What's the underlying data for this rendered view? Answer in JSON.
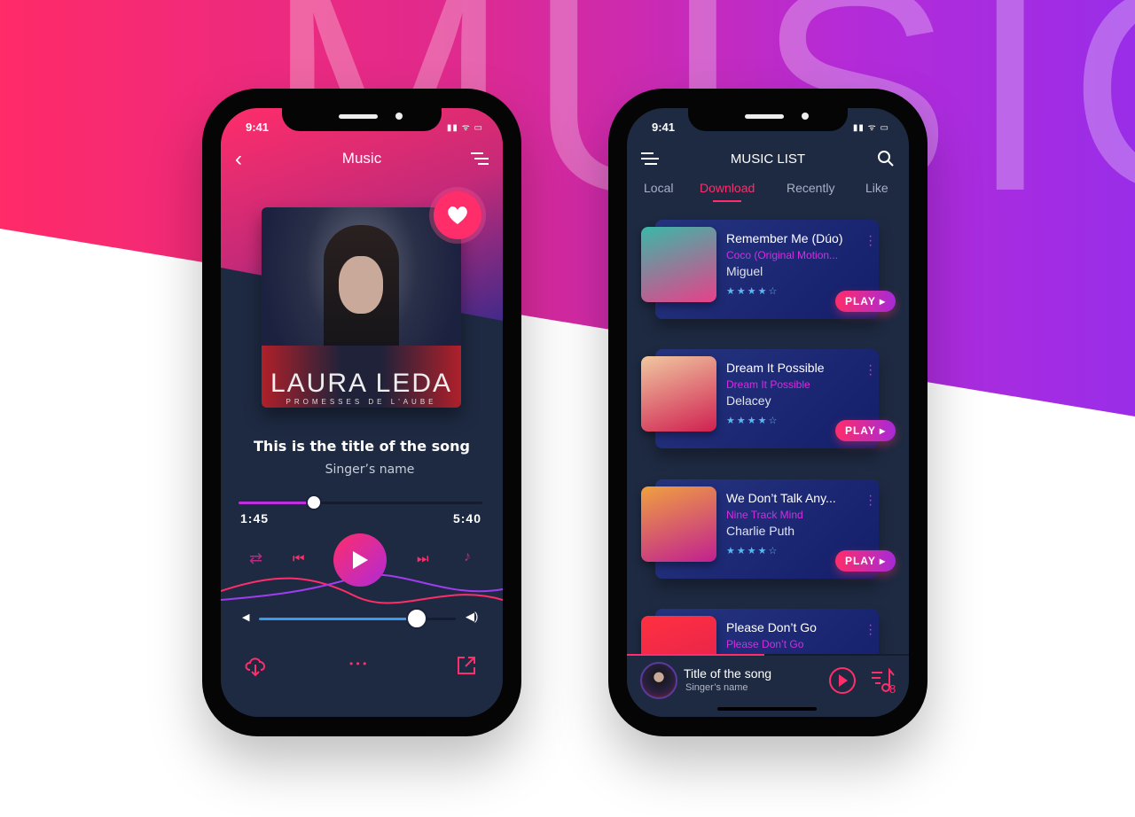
{
  "background": {
    "headline": "MUSIC",
    "accent": "#ff2d6a",
    "accent2": "#a62ad8"
  },
  "player": {
    "status_time": "9:41",
    "title": "Music",
    "album": {
      "artist_art": "LAURA LEDA",
      "subtitle_art": "PROMESSES DE L'AUBE"
    },
    "song_title": "This is the title of the song",
    "singer": "Singer’s name",
    "elapsed": "1:45",
    "duration": "5:40",
    "progress_percent": 30.9,
    "volume_percent": 80,
    "favorited": true,
    "more_label": "• • •"
  },
  "list": {
    "status_time": "9:41",
    "title": "MUSIC LIST",
    "tabs": [
      {
        "label": "Local"
      },
      {
        "label": "Download",
        "active": true
      },
      {
        "label": "Recently"
      },
      {
        "label": "Like"
      }
    ],
    "songs": [
      {
        "title": "Remember Me (Dúo)",
        "album": "Coco (Original Motion...",
        "artist": "Miguel",
        "rating": 4,
        "stars": "★★★★☆",
        "play": "PLAY ▸",
        "colors": [
          "#3ab8a8",
          "#e8408a"
        ]
      },
      {
        "title": "Dream It Possible",
        "album": "Dream It Possible",
        "artist": "Delacey",
        "rating": 4,
        "stars": "★★★★☆",
        "play": "PLAY ▸",
        "colors": [
          "#f0c8a0",
          "#d02050"
        ]
      },
      {
        "title": "We Don’t Talk Any...",
        "album": "Nine Track Mind",
        "artist": "Charlie Puth",
        "rating": 4,
        "stars": "★★★★☆",
        "play": "PLAY ▸",
        "colors": [
          "#f0a040",
          "#c02090"
        ]
      },
      {
        "title": "Please Don’t Go",
        "album": "Please Don’t Go",
        "colors": [
          "#ff3040",
          "#e02050"
        ]
      }
    ],
    "mini_player": {
      "title": "Title of the song",
      "singer": "Singer’s name",
      "queue_count": "8"
    }
  }
}
